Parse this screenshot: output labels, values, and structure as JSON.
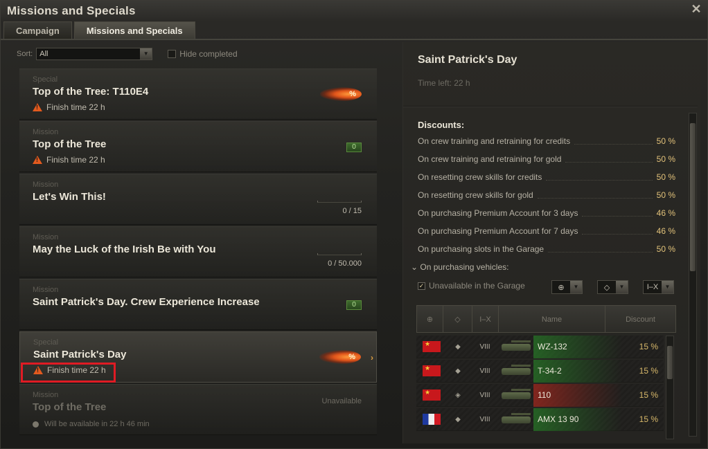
{
  "window": {
    "title": "Missions and Specials",
    "close_glyph": "✕"
  },
  "tabs": [
    {
      "label": "Campaign"
    },
    {
      "label": "Missions and Specials"
    }
  ],
  "filters": {
    "sort_label": "Sort:",
    "sort_value": "All",
    "hide_completed_label": "Hide completed"
  },
  "missions": [
    {
      "type": "Special",
      "title": "Top of the Tree: T110E4",
      "warn": "Finish time 22 h",
      "badge": "%"
    },
    {
      "type": "Mission",
      "title": "Top of the Tree",
      "warn": "Finish time 22 h",
      "counter": "0"
    },
    {
      "type": "Mission",
      "title": "Let's Win This!",
      "progress": "0 / 15"
    },
    {
      "type": "Mission",
      "title": "May the Luck of the Irish Be with You",
      "progress": "0 / 50.000"
    },
    {
      "type": "Mission",
      "title": "Saint Patrick's Day. Crew Experience Increase",
      "counter": "0"
    },
    {
      "type": "Special",
      "title": "Saint Patrick's Day",
      "warn": "Finish time 22 h",
      "badge": "%",
      "chevron": "›"
    },
    {
      "type": "Mission",
      "title": "Top of the Tree",
      "status": "Unavailable",
      "sub": "Will be available in 22 h 46 min"
    }
  ],
  "details": {
    "title": "Saint Patrick's Day",
    "time_left": "Time left: 22 h",
    "discounts_heading": "Discounts:",
    "discounts": [
      {
        "label": "On crew training and retraining for credits",
        "value": "50 %"
      },
      {
        "label": "On crew training and retraining for gold",
        "value": "50 %"
      },
      {
        "label": "On resetting crew skills for credits",
        "value": "50 %"
      },
      {
        "label": "On resetting crew skills for gold",
        "value": "50 %"
      },
      {
        "label": "On purchasing Premium Account for 3 days",
        "value": "46 %"
      },
      {
        "label": "On purchasing Premium Account for 7 days",
        "value": "46 %"
      },
      {
        "label": "On purchasing slots in the Garage",
        "value": "50 %"
      }
    ],
    "vehicles_heading": "On purchasing vehicles:",
    "unavailable_label": "Unavailable in the Garage",
    "filter_tier_label": "I–X",
    "table_headers": {
      "tier": "I–X",
      "name": "Name",
      "discount": "Discount"
    },
    "vehicles": [
      {
        "nation": "china",
        "class": "◆",
        "tier": "VIII",
        "name": "WZ-132",
        "discount": "15 %",
        "tint": "green"
      },
      {
        "nation": "china",
        "class": "◆",
        "tier": "VIII",
        "name": "T-34-2",
        "discount": "15 %",
        "tint": "green"
      },
      {
        "nation": "china",
        "class": "◈",
        "tier": "VIII",
        "name": "110",
        "discount": "15 %",
        "tint": "red"
      },
      {
        "nation": "france",
        "class": "◆",
        "tier": "VIII",
        "name": "AMX 13 90",
        "discount": "15 %",
        "tint": "green"
      }
    ]
  },
  "colors": {
    "accent": "#e2c27a",
    "warning": "#e35a1e",
    "highlight_box": "#e01b24"
  }
}
